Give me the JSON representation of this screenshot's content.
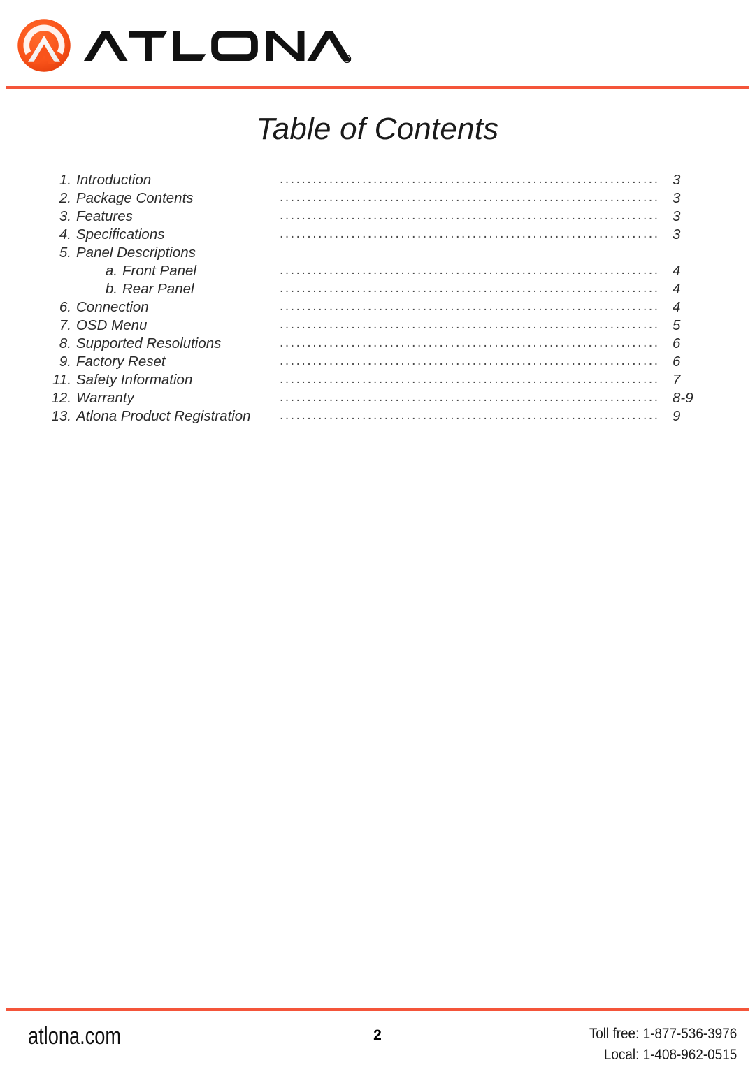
{
  "brand": {
    "logo_icon": "atlona-chevron-circle-logo",
    "wordmark": "ATLONA",
    "registered_mark": "®",
    "accent_color": "#F4553A"
  },
  "document": {
    "title": "Table of Contents"
  },
  "toc": {
    "entries": [
      {
        "number": "1.",
        "title": "Introduction",
        "page": "3",
        "sub": false,
        "has_leader": true
      },
      {
        "number": "2.",
        "title": "Package Contents",
        "page": "3",
        "sub": false,
        "has_leader": true
      },
      {
        "number": "3.",
        "title": "Features",
        "page": "3",
        "sub": false,
        "has_leader": true
      },
      {
        "number": "4.",
        "title": "Specifications",
        "page": "3",
        "sub": false,
        "has_leader": true
      },
      {
        "number": "5.",
        "title": "Panel Descriptions",
        "page": "",
        "sub": false,
        "has_leader": false
      },
      {
        "number": "a.",
        "title": "Front Panel",
        "page": "4",
        "sub": true,
        "has_leader": true
      },
      {
        "number": "b.",
        "title": "Rear Panel",
        "page": "4",
        "sub": true,
        "has_leader": true
      },
      {
        "number": "6.",
        "title": "Connection",
        "page": "4",
        "sub": false,
        "has_leader": true
      },
      {
        "number": "7.",
        "title": "OSD Menu",
        "page": "5",
        "sub": false,
        "has_leader": true
      },
      {
        "number": "8.",
        "title": "Supported Resolutions",
        "page": "6",
        "sub": false,
        "has_leader": true
      },
      {
        "number": "9.",
        "title": "Factory Reset",
        "page": "6",
        "sub": false,
        "has_leader": true
      },
      {
        "number": "11.",
        "title": "Safety Information",
        "page": "7",
        "sub": false,
        "has_leader": true
      },
      {
        "number": "12.",
        "title": "Warranty",
        "page": "8-9",
        "sub": false,
        "has_leader": true
      },
      {
        "number": "13.",
        "title": "Atlona Product Registration",
        "page": "9",
        "sub": false,
        "has_leader": true
      }
    ],
    "leader_dots": "........................................................................................................................"
  },
  "footer": {
    "website": "atlona.com",
    "page_number": "2",
    "toll_free": "Toll free: 1-877-536-3976",
    "local": "Local: 1-408-962-0515"
  }
}
